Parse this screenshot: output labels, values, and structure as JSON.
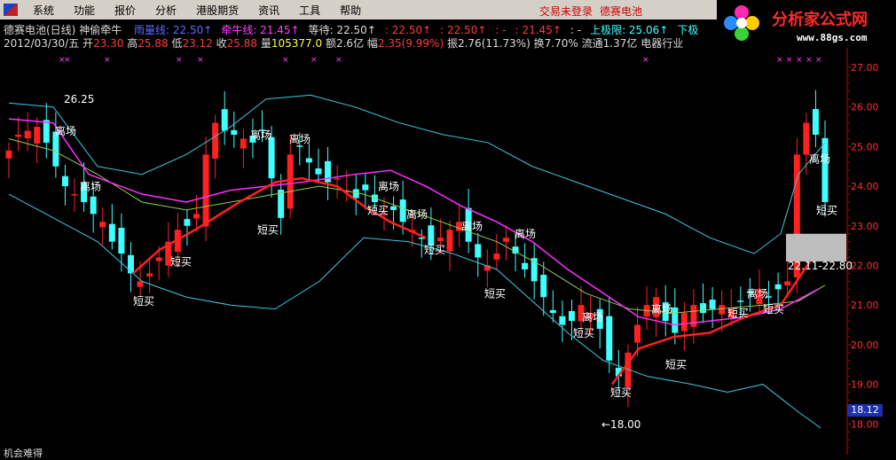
{
  "menu": {
    "items": [
      "系统",
      "功能",
      "报价",
      "分析",
      "港股期货",
      "资讯",
      "工具",
      "帮助"
    ],
    "status": "交易未登录",
    "stock": "德赛电池"
  },
  "brand": {
    "title": "分析家公式网",
    "url": "www.88gs.com"
  },
  "info1": {
    "name": "德赛电池(日线)",
    "indicator": "神偷牵牛",
    "fields": [
      {
        "label": "雨量线:",
        "value": "22.50↑",
        "color": "#5a6cff"
      },
      {
        "label": "牵牛线:",
        "value": "21.45↑",
        "color": "#ff40ff"
      },
      {
        "label": "等待:",
        "value": "22.50↑",
        "color": "#dcdcdc"
      },
      {
        "label": ":",
        "value": "22.50↑",
        "color": "#ff3b3b"
      },
      {
        "label": ":",
        "value": "22.50↑",
        "color": "#ff3b3b"
      },
      {
        "label": ":",
        "value": "-",
        "color": "#ff3b3b"
      },
      {
        "label": ":",
        "value": "21.45↑",
        "color": "#ff3b3b"
      },
      {
        "label": ":",
        "value": "-",
        "color": "#dcdcdc"
      },
      {
        "label": "上极限:",
        "value": "25.06↑",
        "color": "#40ffff"
      },
      {
        "label": "下极",
        "value": "",
        "color": "#40ffff"
      }
    ]
  },
  "info2": {
    "date": "2012/03/30/五",
    "open_label": "开",
    "open": "23.30",
    "high_label": "高",
    "high": "25.88",
    "low_label": "低",
    "low": "23.12",
    "close_label": "收",
    "close": "25.88",
    "vol_label": "量",
    "vol": "105377.0",
    "amt_label": "额",
    "amt": "2.6亿",
    "chg_label": "幅",
    "chg": "2.35(9.99%)",
    "amp_label": "振",
    "amp": "2.76(11.73%)",
    "turn_label": "换",
    "turn": "7.70%",
    "float_label": "流通",
    "float": "1.37亿",
    "industry": "电器行业"
  },
  "axis": {
    "y_ticks": [
      "27.00",
      "26.00",
      "25.00",
      "24.00",
      "23.00",
      "22.00",
      "21.00",
      "20.00",
      "19.00",
      "18.00"
    ],
    "current_price": "18.12"
  },
  "annotations": {
    "high_mark": "26.25",
    "low_mark": "←18.00",
    "range_mark": "22.11-22.80",
    "buy": "短买",
    "sell": "离场"
  },
  "colors": {
    "up": "#ff2020",
    "down": "#40ffff",
    "upper_band": "#40c8e0",
    "mid_line": "#8fd04a",
    "rain_line": "#ff30ff",
    "pull_line": "#ff2020"
  },
  "bottom": {
    "text": "机会难得"
  }
}
